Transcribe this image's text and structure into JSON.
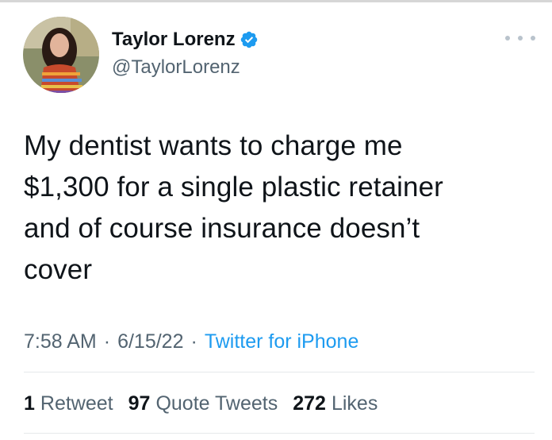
{
  "author": {
    "display_name": "Taylor Lorenz",
    "handle": "@TaylorLorenz",
    "verified": true,
    "verified_icon": "verified-badge-icon",
    "avatar": "profile-photo"
  },
  "more_icon": "more-options-icon",
  "tweet": {
    "lines": [
      "My dentist wants to charge me",
      "$1,300 for a single plastic retainer",
      "and of course insurance doesn’t",
      "cover"
    ]
  },
  "meta": {
    "time": "7:58 AM",
    "date": "6/15/22",
    "separator": "·",
    "source": "Twitter for iPhone"
  },
  "stats": [
    {
      "count": "1",
      "label": "Retweet"
    },
    {
      "count": "97",
      "label": "Quote Tweets"
    },
    {
      "count": "272",
      "label": "Likes"
    }
  ],
  "colors": {
    "text": "#0f1419",
    "secondary": "#536471",
    "accent": "#1d9bf0"
  }
}
